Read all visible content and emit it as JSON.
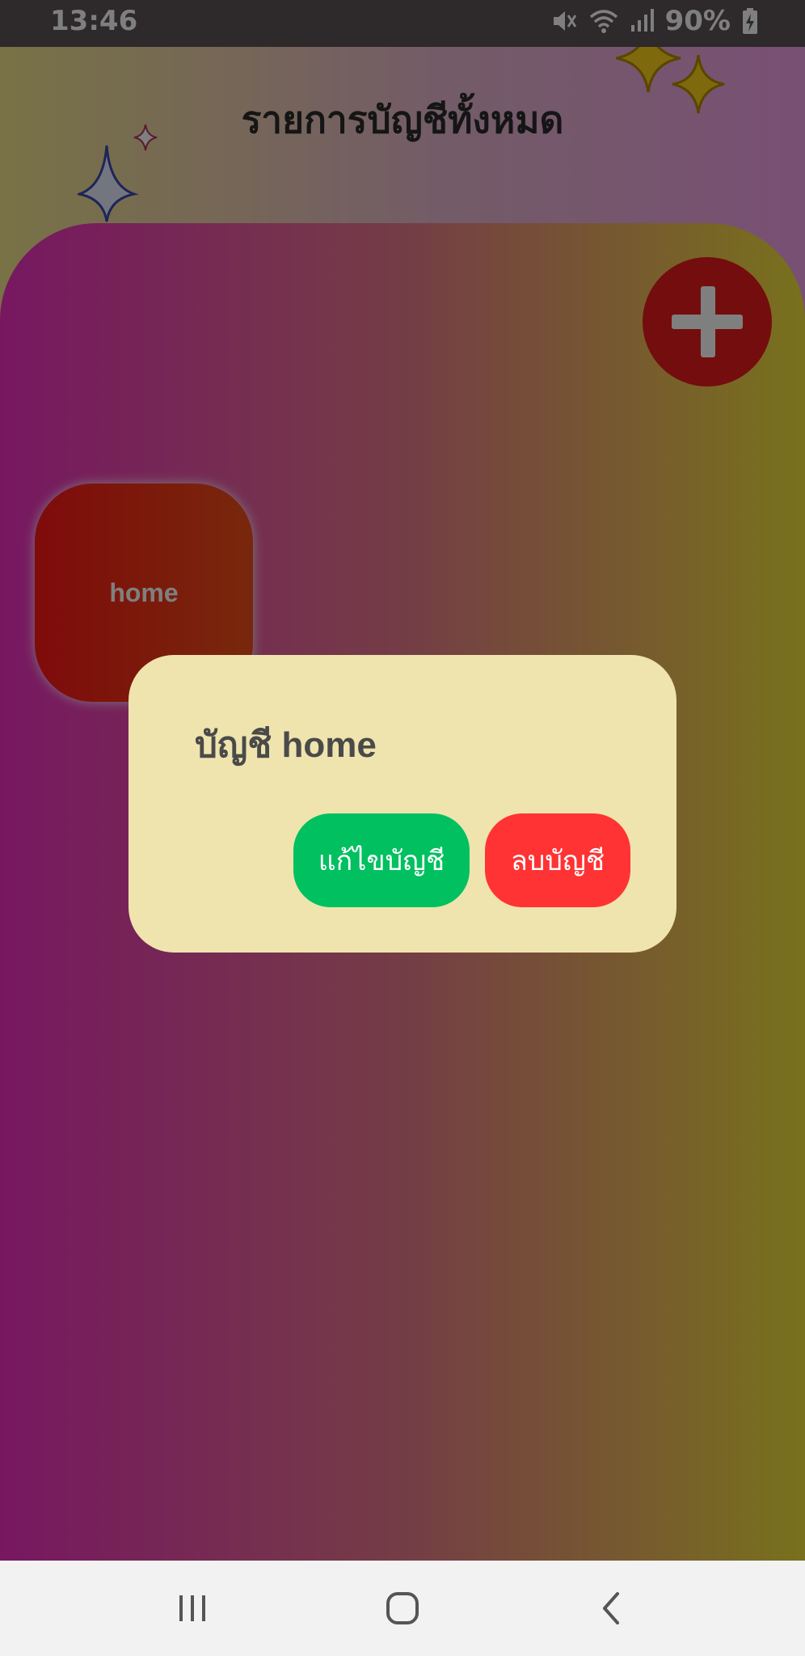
{
  "status_bar": {
    "time": "13:46",
    "battery": "90%",
    "icons": [
      "mute-icon",
      "wifi-icon",
      "signal-icon",
      "battery-charging-icon"
    ]
  },
  "header": {
    "title": "รายการบัญชีทั้งหมด"
  },
  "accounts": [
    {
      "name": "home"
    }
  ],
  "add_button": {
    "icon": "plus-icon",
    "color": "#e81b1b"
  },
  "dialog": {
    "title": "บัญชี home",
    "edit_label": "แก้ไขบัญชี",
    "delete_label": "ลบบัญชี",
    "edit_color": "#00c060",
    "delete_color": "#ff3333",
    "background": "#efe4ad"
  },
  "nav_bar": {
    "items": [
      "recent-apps-icon",
      "home-icon",
      "back-icon"
    ]
  }
}
